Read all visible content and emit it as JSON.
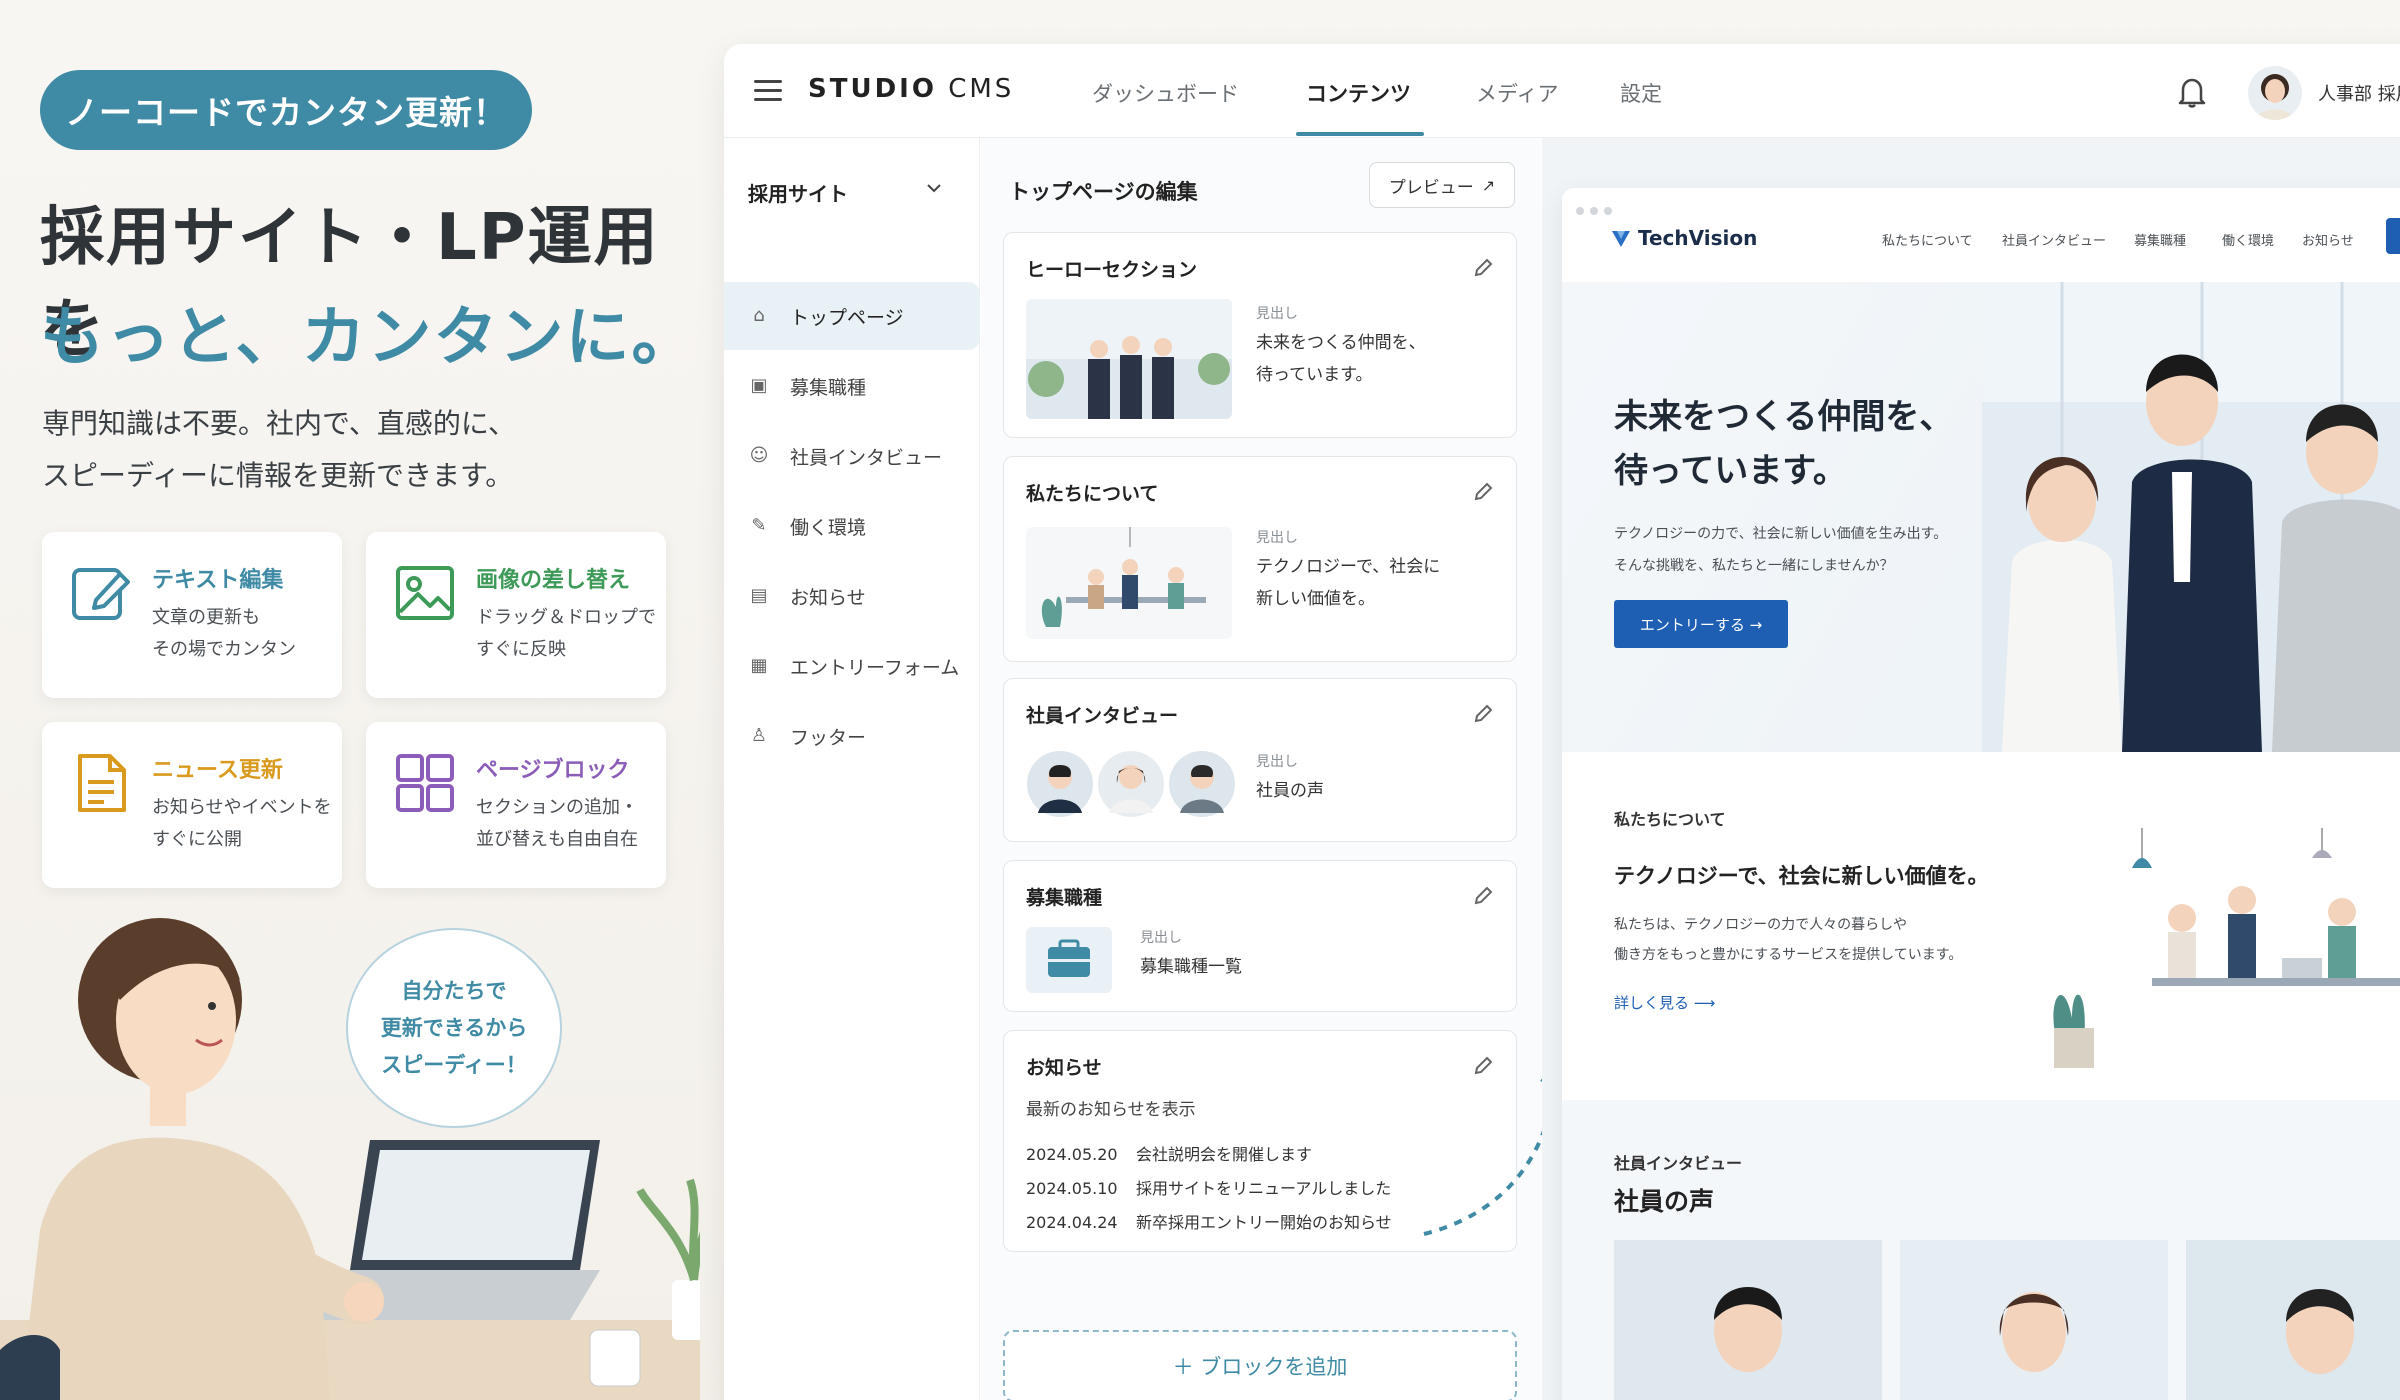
{
  "promo": {
    "badge": "ノーコードでカンタン更新！",
    "headline_line1": "採用サイト・LP運用を",
    "headline_line2": "もっと、カンタンに。",
    "lead_line1": "専門知識は不要。社内で、直感的に、",
    "lead_line2": "スピーディーに情報を更新できます。",
    "features": [
      {
        "icon": "edit-icon",
        "title": "テキスト編集",
        "desc1": "文章の更新も",
        "desc2": "その場でカンタン",
        "color": "#3f8aa4"
      },
      {
        "icon": "image-icon",
        "title": "画像の差し替え",
        "desc1": "ドラッグ＆ドロップで",
        "desc2": "すぐに反映",
        "color": "#3e9a58"
      },
      {
        "icon": "document-icon",
        "title": "ニュース更新",
        "desc1": "お知らせやイベントを",
        "desc2": "すぐに公開",
        "color": "#d99a1e"
      },
      {
        "icon": "blocks-icon",
        "title": "ページブロック",
        "desc1": "セクションの追加・",
        "desc2": "並び替えも自由自在",
        "color": "#8c5db8"
      }
    ],
    "bubble_line1": "自分たちで",
    "bubble_line2": "更新できるから",
    "bubble_line3": "スピーディー！"
  },
  "cms": {
    "brand_bold": "STUDIO",
    "brand_light": " CMS",
    "nav": [
      "ダッシュボード",
      "コンテンツ",
      "メディア",
      "設定"
    ],
    "nav_active_index": 1,
    "user_name": "人事部 採用",
    "sidebar": {
      "site_select": "採用サイト",
      "items": [
        {
          "label": "トップページ",
          "icon": "home-icon",
          "active": true
        },
        {
          "label": "募集職種",
          "icon": "briefcase-icon",
          "active": false
        },
        {
          "label": "社員インタビュー",
          "icon": "person-icon",
          "active": false
        },
        {
          "label": "働く環境",
          "icon": "pen-icon",
          "active": false
        },
        {
          "label": "お知らせ",
          "icon": "document-icon",
          "active": false
        },
        {
          "label": "エントリーフォーム",
          "icon": "form-icon",
          "active": false
        },
        {
          "label": "フッター",
          "icon": "footer-icon",
          "active": false
        }
      ]
    },
    "editor": {
      "title": "トップページの編集",
      "preview_button": "プレビュー",
      "hero_card": {
        "title": "ヒーローセクション",
        "label": "見出し",
        "value1": "未来をつくる仲間を、",
        "value2": "待っています。"
      },
      "about_card": {
        "title": "私たちについて",
        "label": "見出し",
        "value1": "テクノロジーで、社会に",
        "value2": "新しい価値を。"
      },
      "interview_card": {
        "title": "社員インタビュー",
        "label": "見出し",
        "value": "社員の声"
      },
      "jobs_card": {
        "title": "募集職種",
        "label": "見出し",
        "value": "募集職種一覧"
      },
      "news_card": {
        "title": "お知らせ",
        "subtitle": "最新のお知らせを表示",
        "rows": [
          {
            "date": "2024.05.20",
            "text": "会社説明会を開催します"
          },
          {
            "date": "2024.05.10",
            "text": "採用サイトをリニューアルしました"
          },
          {
            "date": "2024.04.24",
            "text": "新卒採用エントリー開始のお知らせ"
          }
        ]
      },
      "add_block": "＋  ブロックを追加"
    },
    "preview": {
      "logo": "TechVision",
      "nav": [
        "私たちについて",
        "社員インタビュー",
        "募集職種",
        "働く環境",
        "お知らせ"
      ],
      "hero_title1": "未来をつくる仲間を、",
      "hero_title2": "待っています。",
      "hero_text1": "テクノロジーの力で、社会に新しい価値を生み出す。",
      "hero_text2": "そんな挑戦を、私たちと一緒にしませんか？",
      "hero_button": "エントリーする  →",
      "about_label": "私たちについて",
      "about_title": "テクノロジーで、社会に新しい価値を。",
      "about_text1": "私たちは、テクノロジーの力で人々の暮らしや",
      "about_text2": "働き方をもっと豊かにするサービスを提供しています。",
      "about_link": "詳しく見る  ⟶",
      "interview_label": "社員インタビュー",
      "interview_title": "社員の声"
    }
  }
}
